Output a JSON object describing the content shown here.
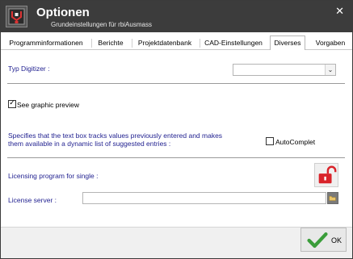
{
  "window": {
    "title": "Optionen",
    "subtitle": "Grundeinstellungen für rbiAusmass",
    "close_symbol": "✕"
  },
  "tabs": [
    {
      "label": "Programminformationen",
      "active": false
    },
    {
      "label": "Berichte",
      "active": false
    },
    {
      "label": "Projektdatenbank",
      "active": false
    },
    {
      "label": "CAD-Einstellungen",
      "active": false
    },
    {
      "label": "Diverses",
      "active": true
    },
    {
      "label": "Vorgaben",
      "active": false
    }
  ],
  "diverses": {
    "typ_digitizer_label": "Typ Digitizer :",
    "typ_digitizer_value": "",
    "see_graphic_preview_label": "See graphic preview",
    "see_graphic_preview_checked": true,
    "autocomplete_description_line1": "Specifies that the text box tracks values previously entered and makes",
    "autocomplete_description_line2": "them available in a dynamic list of suggested entries :",
    "autocomplete_label": "AutoComplet",
    "autocomplete_checked": false,
    "licensing_label": "Licensing program for single :",
    "license_server_label": "License server :",
    "license_server_value": ""
  },
  "footer": {
    "ok_label": "OK"
  },
  "icons": {
    "app": "app-logo-icon",
    "lock": "unlocked-padlock-icon",
    "folder": "folder-icon",
    "ok": "green-checkmark-icon",
    "combo_arrow": "chevron-down-icon"
  },
  "colors": {
    "titlebar": "#3c3c3c",
    "label_blue": "#1f1f8f",
    "lock_red": "#d9232a",
    "ok_green": "#3a9d3a"
  }
}
